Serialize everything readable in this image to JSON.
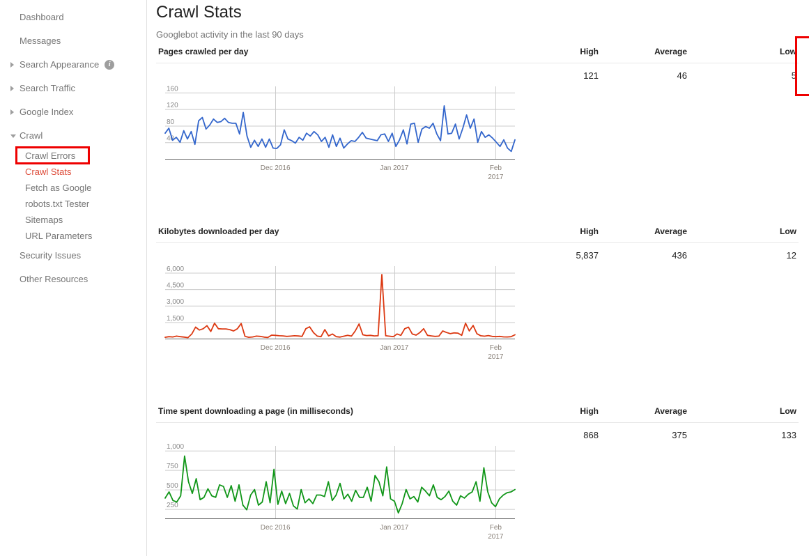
{
  "sidebar": {
    "items": [
      {
        "label": "Dashboard",
        "type": "top",
        "arrow": "none"
      },
      {
        "label": "Messages",
        "type": "top",
        "arrow": "none"
      },
      {
        "label": "Search Appearance",
        "type": "top",
        "arrow": "collapsed",
        "info": true,
        "info_glyph": "i"
      },
      {
        "label": "Search Traffic",
        "type": "top",
        "arrow": "collapsed"
      },
      {
        "label": "Google Index",
        "type": "top",
        "arrow": "collapsed"
      },
      {
        "label": "Crawl",
        "type": "top",
        "arrow": "expanded"
      },
      {
        "label": "Crawl Errors",
        "type": "sub"
      },
      {
        "label": "Crawl Stats",
        "type": "sub",
        "active": true
      },
      {
        "label": "Fetch as Google",
        "type": "sub"
      },
      {
        "label": "robots.txt Tester",
        "type": "sub"
      },
      {
        "label": "Sitemaps",
        "type": "sub"
      },
      {
        "label": "URL Parameters",
        "type": "sub"
      },
      {
        "label": "Security Issues",
        "type": "top",
        "arrow": "none"
      },
      {
        "label": "Other Resources",
        "type": "top",
        "arrow": "none"
      }
    ],
    "highlight_color": "#ee0000",
    "active_color": "#dd4b39"
  },
  "header": {
    "title": "Crawl Stats",
    "subtitle": "Googlebot activity in the last 90 days"
  },
  "columns": {
    "high": "High",
    "average": "Average",
    "low": "Low"
  },
  "highlight": {
    "target": "average",
    "color": "#ee0000"
  },
  "sections": [
    {
      "title": "Pages crawled per day",
      "high": "121",
      "average": "46",
      "low": "5"
    },
    {
      "title": "Kilobytes downloaded per day",
      "high": "5,837",
      "average": "436",
      "low": "12"
    },
    {
      "title": "Time spent downloading a page (in milliseconds)",
      "high": "868",
      "average": "375",
      "low": "133"
    }
  ],
  "chart_data": [
    {
      "type": "line",
      "title": "Pages crawled per day",
      "xlabel": "",
      "ylabel": "",
      "color": "#3366cc",
      "grid": true,
      "legend": "none",
      "yticks": [
        40,
        80,
        120,
        160
      ],
      "ytick_labels": [
        "40",
        "80",
        "120",
        "160"
      ],
      "ylim": [
        0,
        175
      ],
      "xtick_labels": [
        "Dec 2016",
        "Jan 2017",
        "Feb\n2017"
      ],
      "xtick_positions": [
        0.315,
        0.655,
        0.945
      ],
      "x": "day index 0..89 spanning 2016-11-05 to 2017-02-02",
      "values": [
        62,
        74,
        45,
        52,
        40,
        68,
        48,
        66,
        35,
        92,
        100,
        72,
        82,
        96,
        88,
        90,
        98,
        88,
        86,
        86,
        60,
        112,
        55,
        28,
        45,
        30,
        48,
        28,
        48,
        26,
        25,
        34,
        70,
        48,
        44,
        38,
        52,
        45,
        62,
        55,
        66,
        58,
        42,
        52,
        28,
        58,
        30,
        50,
        26,
        36,
        44,
        42,
        52,
        64,
        50,
        48,
        46,
        44,
        58,
        60,
        42,
        62,
        30,
        46,
        70,
        36,
        84,
        86,
        40,
        72,
        78,
        74,
        86,
        60,
        44,
        128,
        60,
        62,
        84,
        48,
        74,
        106,
        74,
        96,
        40,
        66,
        52,
        58,
        50,
        40,
        30,
        46,
        26,
        18,
        46
      ]
    },
    {
      "type": "line",
      "title": "Kilobytes downloaded per day",
      "xlabel": "",
      "ylabel": "",
      "color": "#dc3912",
      "grid": true,
      "legend": "none",
      "yticks": [
        1500,
        3000,
        4500,
        6000
      ],
      "ytick_labels": [
        "1,500",
        "3,000",
        "4,500",
        "6,000"
      ],
      "ylim": [
        0,
        6600
      ],
      "xtick_labels": [
        "Dec 2016",
        "Jan 2017",
        "Feb\n2017"
      ],
      "xtick_positions": [
        0.315,
        0.655,
        0.945
      ],
      "values": [
        120,
        180,
        150,
        230,
        180,
        140,
        90,
        420,
        1050,
        780,
        900,
        1180,
        650,
        1400,
        900,
        880,
        880,
        820,
        700,
        900,
        1380,
        200,
        120,
        150,
        230,
        200,
        140,
        100,
        320,
        300,
        260,
        250,
        200,
        230,
        260,
        240,
        200,
        900,
        1080,
        550,
        230,
        180,
        820,
        250,
        420,
        180,
        140,
        220,
        300,
        230,
        700,
        1340,
        350,
        280,
        300,
        250,
        260,
        5837,
        260,
        220,
        180,
        420,
        300,
        900,
        1050,
        420,
        320,
        550,
        900,
        300,
        250,
        200,
        230,
        700,
        560,
        450,
        520,
        500,
        300,
        1400,
        700,
        1200,
        450,
        260,
        220,
        280,
        200,
        180,
        200,
        160,
        150,
        180,
        350
      ]
    },
    {
      "type": "line",
      "title": "Time spent downloading a page (in milliseconds)",
      "xlabel": "",
      "ylabel": "",
      "color": "#109618",
      "grid": true,
      "legend": "none",
      "yticks": [
        250,
        500,
        750,
        1000
      ],
      "ytick_labels": [
        "250",
        "500",
        "750",
        "1,000"
      ],
      "ylim": [
        130,
        1060
      ],
      "xtick_labels": [
        "Dec 2016",
        "Jan 2017",
        "Feb\n2017"
      ],
      "xtick_positions": [
        0.315,
        0.655,
        0.945
      ],
      "values": [
        390,
        470,
        360,
        340,
        420,
        930,
        600,
        450,
        640,
        370,
        400,
        510,
        420,
        400,
        560,
        540,
        400,
        550,
        350,
        560,
        300,
        240,
        430,
        500,
        300,
        340,
        600,
        330,
        760,
        310,
        480,
        320,
        450,
        290,
        250,
        500,
        330,
        380,
        320,
        430,
        430,
        410,
        600,
        360,
        430,
        580,
        380,
        440,
        350,
        490,
        400,
        400,
        530,
        350,
        680,
        600,
        420,
        790,
        380,
        350,
        200,
        320,
        500,
        380,
        410,
        340,
        530,
        480,
        420,
        560,
        400,
        370,
        410,
        480,
        350,
        300,
        420,
        390,
        440,
        470,
        600,
        350,
        780,
        470,
        330,
        280,
        380,
        430,
        460,
        470,
        500
      ]
    }
  ]
}
